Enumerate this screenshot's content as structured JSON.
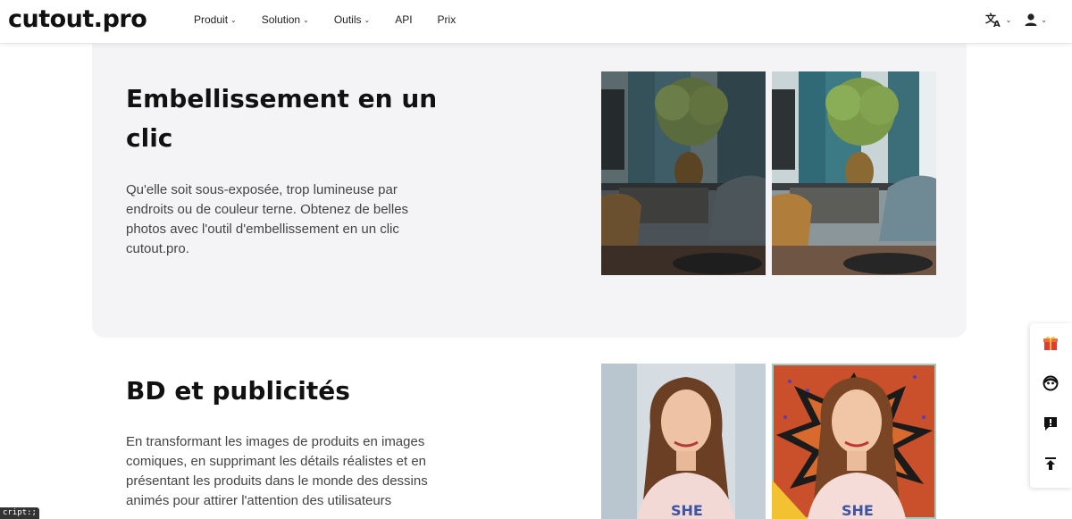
{
  "header": {
    "logo": "cutout.pro",
    "nav": [
      {
        "label": "Produit",
        "dropdown": true
      },
      {
        "label": "Solution",
        "dropdown": true
      },
      {
        "label": "Outils",
        "dropdown": true
      },
      {
        "label": "API",
        "dropdown": false
      },
      {
        "label": "Prix",
        "dropdown": false
      }
    ],
    "icons": [
      "language-icon",
      "user-icon"
    ]
  },
  "sections": [
    {
      "title": "Embellissement en un clic",
      "description": "Qu'elle soit sous-exposée, trop lumineuse par endroits ou de couleur terne. Obtenez de belles photos avec l'outil d'embellissement en un clic cutout.pro."
    },
    {
      "title": "BD et publicités",
      "description": "En transformant les images de produits en images comiques, en supprimant les détails réalistes et en présentant les produits dans le monde des dessins animés pour attirer l'attention des utilisateurs"
    }
  ],
  "side_panel": [
    "gift-icon",
    "support-icon",
    "feedback-icon",
    "back-to-top-icon"
  ],
  "status_tip": "cript:;",
  "colors": {
    "accent": "#e53935",
    "section_bg": "#f4f4f6"
  }
}
